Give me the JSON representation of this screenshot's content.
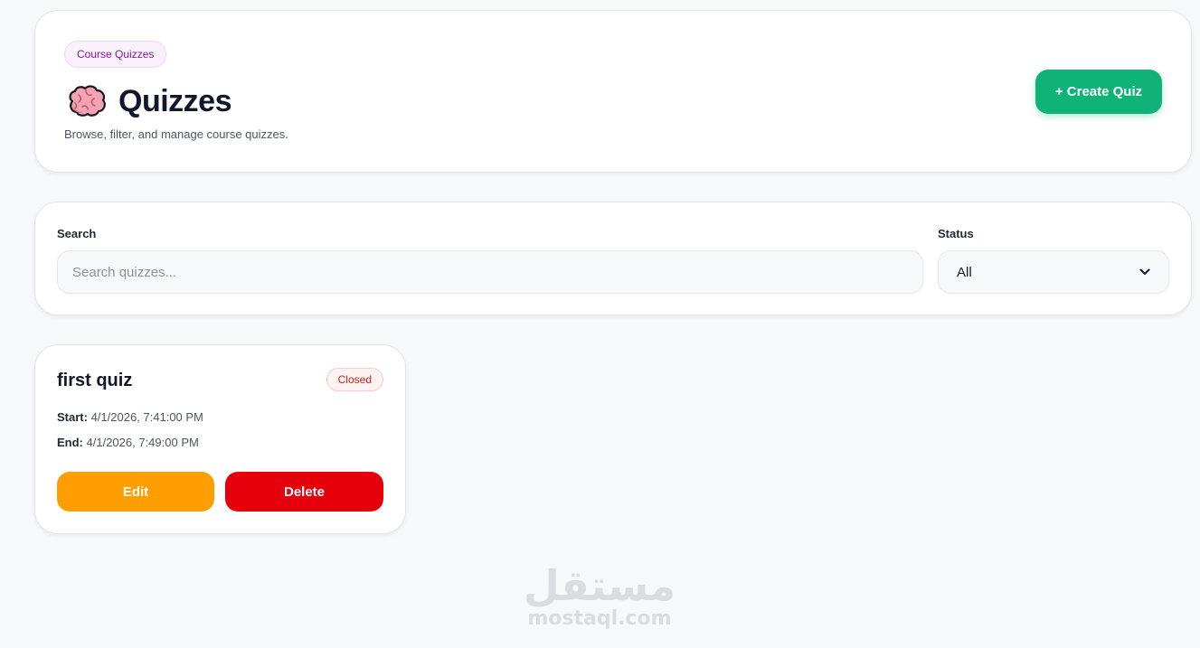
{
  "header": {
    "badge": "Course Quizzes",
    "title": "Quizzes",
    "subtitle": "Browse, filter, and manage course quizzes.",
    "create_label": "+ Create Quiz",
    "icon": "brain-icon"
  },
  "filters": {
    "search_label": "Search",
    "search_placeholder": "Search quizzes...",
    "search_value": "",
    "status_label": "Status",
    "status_value": "All"
  },
  "quizzes": [
    {
      "title": "first quiz",
      "status": "Closed",
      "start_label": "Start:",
      "start_value": "4/1/2026, 7:41:00 PM",
      "end_label": "End:",
      "end_value": "4/1/2026, 7:49:00 PM",
      "edit_label": "Edit",
      "delete_label": "Delete"
    }
  ],
  "watermark": {
    "logo": "مستقل",
    "text": "mostaql.com"
  },
  "colors": {
    "primary": "#10b377",
    "edit": "#ff9e00",
    "delete": "#e5000b",
    "closed_badge": "#c81e1e",
    "course_badge": "#7e1b92",
    "background": "#f7f8fa"
  }
}
